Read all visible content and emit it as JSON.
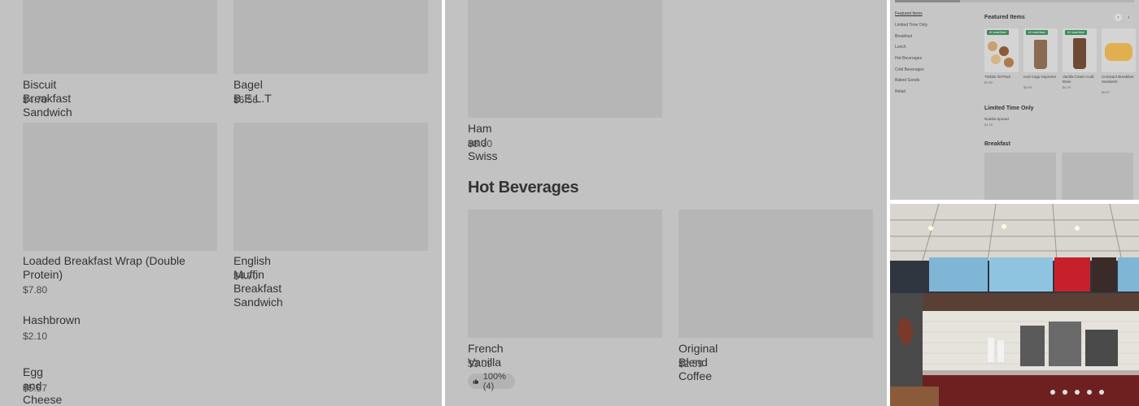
{
  "left_panel": {
    "items": [
      {
        "name": "Biscuit Breakfast Sandwich",
        "price": "$4.70"
      },
      {
        "name": "Bagel B.E.L.T",
        "price": "$6.56"
      },
      {
        "name": "Loaded Breakfast Wrap (Double Protein)",
        "price": "$7.80"
      },
      {
        "name": "English Muffin Breakfast Sandwich",
        "price": "$4.70"
      },
      {
        "name": "Hashbrown",
        "price": "$2.10"
      },
      {
        "name": "Egg and Cheese Bagel",
        "price": "$5.57"
      }
    ]
  },
  "mid_panel": {
    "top_item": {
      "name": "Ham and Swiss",
      "price": "$8.30"
    },
    "section_title": "Hot Beverages",
    "items": [
      {
        "name": "French Vanilla",
        "price": "$3.09",
        "rating": "100% (4)"
      },
      {
        "name": "Original Blend Coffee",
        "price": "$2.59"
      }
    ]
  },
  "mini_site": {
    "nav": [
      "Featured Items",
      "Limited Time Only",
      "Breakfast",
      "Lunch",
      "Hot Beverages",
      "Cold Beverages",
      "Baked Goods",
      "Retail"
    ],
    "featured_title": "Featured Items",
    "featured": [
      {
        "name": "Timbits 20-Pack",
        "price": "$7.80",
        "badge": "#1 most liked",
        "color": "#caa070"
      },
      {
        "name": "Iced Capp Supreme",
        "price": "$5.99",
        "badge": "#1 most liked",
        "color": "#8a6a50"
      },
      {
        "name": "Vanilla Cream Cold Brew",
        "price": "$4.20",
        "badge": "#1 most liked",
        "color": "#6e4a34"
      },
      {
        "name": "Croissant Breakfast Sandwich",
        "price": "$5.57",
        "color": "#e0b050"
      }
    ],
    "limited_title": "Limited Time Only",
    "limited_item": {
      "name": "Nutella Spread",
      "price": "$1.29"
    },
    "breakfast_title": "Breakfast",
    "arrow_prev": "‹",
    "arrow_next": "›"
  },
  "colors": {
    "panel_bg": "#c2c2c2",
    "thumb_bg": "#b6b6b6",
    "badge_green": "#3f8a5a"
  }
}
